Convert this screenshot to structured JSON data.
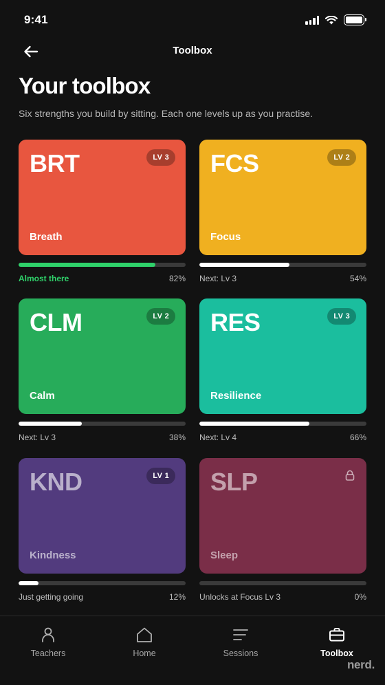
{
  "status_bar": {
    "time": "9:41"
  },
  "header": {
    "title": "Toolbox"
  },
  "page": {
    "title": "Your toolbox",
    "subtitle": "Six strengths you build by sitting. Each one levels up as you practise."
  },
  "tools": [
    {
      "code": "BRT",
      "name": "Breath",
      "level": "LV 3",
      "progress": 0.82,
      "percent": "82%",
      "note": "Almost there",
      "color": "#E8563F"
    },
    {
      "code": "FCS",
      "name": "Focus",
      "level": "LV 2",
      "progress": 0.54,
      "percent": "54%",
      "note": "Next: Lv 3",
      "color": "#F0B020"
    },
    {
      "code": "CLM",
      "name": "Calm",
      "level": "LV 2",
      "progress": 0.38,
      "percent": "38%",
      "note": "Next: Lv 3",
      "color": "#27AC5A"
    },
    {
      "code": "RES",
      "name": "Resilience",
      "level": "LV 3",
      "progress": 0.66,
      "percent": "66%",
      "note": "Next: Lv 4",
      "color": "#1BBE9E"
    },
    {
      "code": "KND",
      "name": "Kindness",
      "level": "LV 1",
      "progress": 0.12,
      "percent": "12%",
      "note": "Just getting going",
      "color": "#523B7E"
    },
    {
      "code": "SLP",
      "name": "Sleep",
      "level": "",
      "locked": true,
      "progress": 0,
      "percent": "0%",
      "note": "Unlocks at Focus Lv 3",
      "color": "#7A2E48"
    }
  ],
  "tab_bar": {
    "tabs": [
      {
        "label": "Teachers",
        "icon": "person-icon"
      },
      {
        "label": "Home",
        "icon": "home-icon"
      },
      {
        "label": "Sessions",
        "icon": "list-icon"
      },
      {
        "label": "Toolbox",
        "icon": "briefcase-icon",
        "active": true
      }
    ]
  },
  "brand": {
    "logo_text": "nerd."
  },
  "colors": {
    "background": "#121212",
    "progress_highlight": "#2FD16A"
  }
}
